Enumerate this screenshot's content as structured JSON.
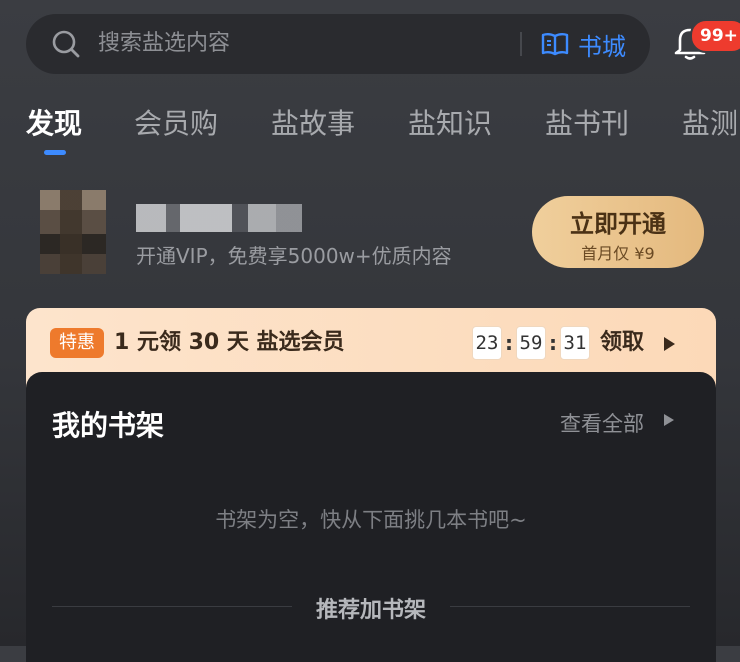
{
  "search": {
    "placeholder": "搜索盐选内容",
    "bookstore_label": "书城",
    "accent": "#3d8bff"
  },
  "notifications": {
    "badge": "99+",
    "badge_color": "#ee3b2e"
  },
  "tabs": [
    {
      "label": "发现",
      "active": true
    },
    {
      "label": "会员购"
    },
    {
      "label": "盐故事"
    },
    {
      "label": "盐知识"
    },
    {
      "label": "盐书刊"
    },
    {
      "label": "盐测"
    }
  ],
  "vip": {
    "description": "开通VIP，免费享5000w+优质内容",
    "button_label": "立即开通",
    "button_sub": "首月仅 ¥9"
  },
  "promo": {
    "badge": "特惠",
    "text": "1 元领 30 天 盐选会员",
    "timer": [
      "23",
      "59",
      "31"
    ],
    "timer_sep": ":",
    "claim_label": "领取"
  },
  "shelf": {
    "title": "我的书架",
    "view_all": "查看全部",
    "empty_text": "书架为空，快从下面挑几本书吧~",
    "recommend_label": "推荐加书架"
  }
}
